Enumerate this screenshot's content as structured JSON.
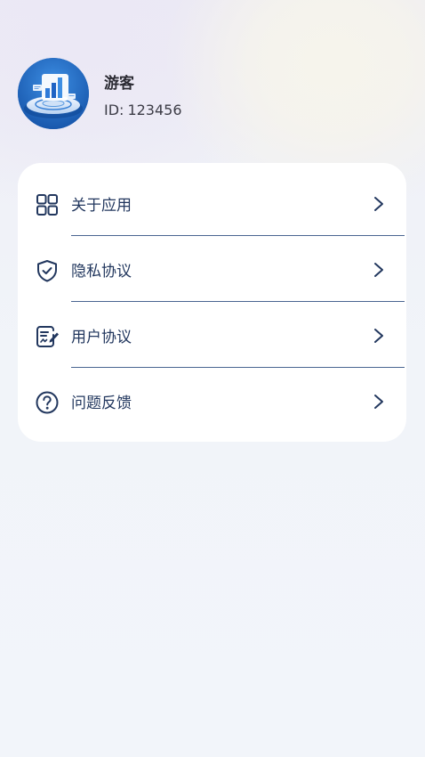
{
  "profile": {
    "name": "游客",
    "id_label": "ID:",
    "id_value": "123456",
    "avatar_icon": "analytics-chart-avatar-icon"
  },
  "menu": {
    "items": [
      {
        "label": "关于应用",
        "icon": "grid-apps-icon"
      },
      {
        "label": "隐私协议",
        "icon": "shield-check-icon"
      },
      {
        "label": "用户协议",
        "icon": "document-sign-icon"
      },
      {
        "label": "问题反馈",
        "icon": "question-circle-icon"
      }
    ],
    "chevron_icon": "chevron-right-icon"
  },
  "colors": {
    "accent": "#22375e",
    "divider": "#4a6591",
    "card": "#ffffff",
    "background": "#f1f4f9"
  }
}
